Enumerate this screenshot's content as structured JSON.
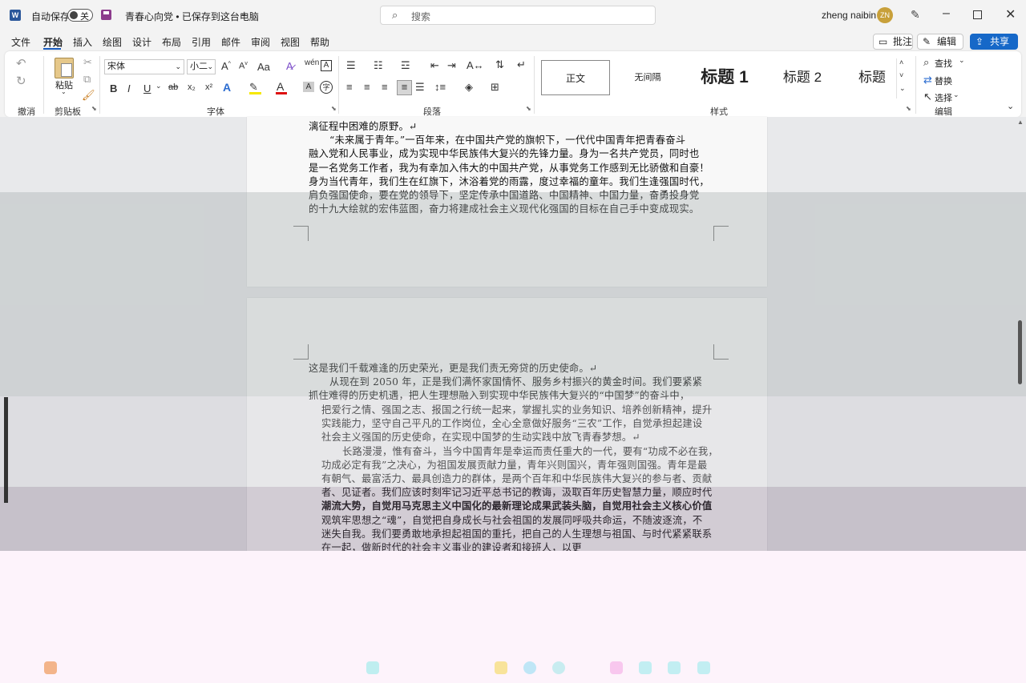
{
  "titlebar": {
    "autosave_label": "自动保存",
    "autosave_state": "关",
    "doc_title": "青春心向党 • 已保存到这台电脑",
    "search_placeholder": "搜索",
    "user_name": "zheng naibin",
    "user_initials": "ZN"
  },
  "menu": {
    "items": [
      "文件",
      "开始",
      "插入",
      "绘图",
      "设计",
      "布局",
      "引用",
      "邮件",
      "审阅",
      "视图",
      "帮助"
    ],
    "active": "开始",
    "comment_label": "批注",
    "edit_label": "编辑",
    "share_label": "共享"
  },
  "ribbon": {
    "groups": {
      "undo": "撤消",
      "clipboard": "剪贴板",
      "font": "字体",
      "paragraph": "段落",
      "styles": "样式",
      "editing": "编辑"
    },
    "paste_label": "粘贴",
    "font_name": "宋体",
    "font_size": "小二",
    "styles": [
      "正文",
      "无间隔",
      "标题 1",
      "标题 2",
      "标题"
    ],
    "find_label": "查找",
    "replace_label": "替换",
    "select_label": "选择",
    "font_buttons": {
      "bold": "B",
      "italic": "I",
      "underline": "U",
      "strike": "ab",
      "sub": "x₂",
      "sup": "x²",
      "aa": "Aa"
    }
  },
  "document": {
    "page1_lines": [
      "漓征程中困难的原野。↵",
      "“未来属于青年。”一百年来，在中国共产党的旗帜下，一代代中国青年把青春奋斗",
      "融入党和人民事业，成为实现中华民族伟大复兴的先锋力量。身为一名共产党员，同时也",
      "是一名党务工作者，我为有幸加入伟大的中国共产党，从事党务工作感到无比骄傲和自豪！",
      "身为当代青年，我们生在红旗下，沐浴着党的雨露，度过幸福的童年。我们生逢强国时代，",
      "肩负强国使命，要在党的领导下，坚定传承中国道路、中国精神、中国力量，奋勇投身党",
      "的十九大绘就的宏伟蓝图，奋力将建成社会主义现代化强国的目标在自己手中变成现实。"
    ],
    "page2_lines": [
      "这是我们千载难逢的历史荣光，更是我们责无旁贷的历史使命。↵",
      "从现在到 2050 年，正是我们满怀家国情怀、服务乡村振兴的黄金时间。我们要紧紧",
      "抓住难得的历史机遇，把人生理想融入到实现中华民族伟大复兴的“中国梦”的奋斗中，",
      "把爱行之情、强国之志、报国之行统一起来，掌握扎实的业务知识、培养创新精神，提升",
      "实践能力，坚守自己平凡的工作岗位，全心全意做好服务“三农”工作，自觉承担起建设",
      "社会主义强国的历史使命，在实现中国梦的生动实践中放飞青春梦想。↵",
      "长路漫漫，惟有奋斗，当今中国青年是幸运而责任重大的一代，要有“功成不必在我，",
      "功成必定有我”之决心，为祖国发展贡献力量，青年兴则国兴，青年强则国强。青年是最",
      "有朝气、最富活力、最具创造力的群体，是两个百年和中华民族伟大复兴的参与者、贡献",
      "者、见证者。我们应该时刻牢记习近平总书记的教诲，汲取百年历史智慧力量，顺应时代",
      "潮流大势，自觉用马克思主义中国化的最新理论成果武装头脑，自觉用社会主义核心价值",
      "观筑牢思想之“魂”，自觉把自身成长与社会祖国的发展同呼吸共命运，不随波逐流，不",
      "迷失自我。我们要勇敢地承担起祖国的重托，把自己的人生理想与祖国、与时代紧紧联系",
      "在一起，做新时代的社会主义事业的建设者和接班人，以更"
    ]
  },
  "colors": {
    "accent": "#185abd",
    "share": "#1668c8",
    "word_blue": "#2b579a"
  }
}
